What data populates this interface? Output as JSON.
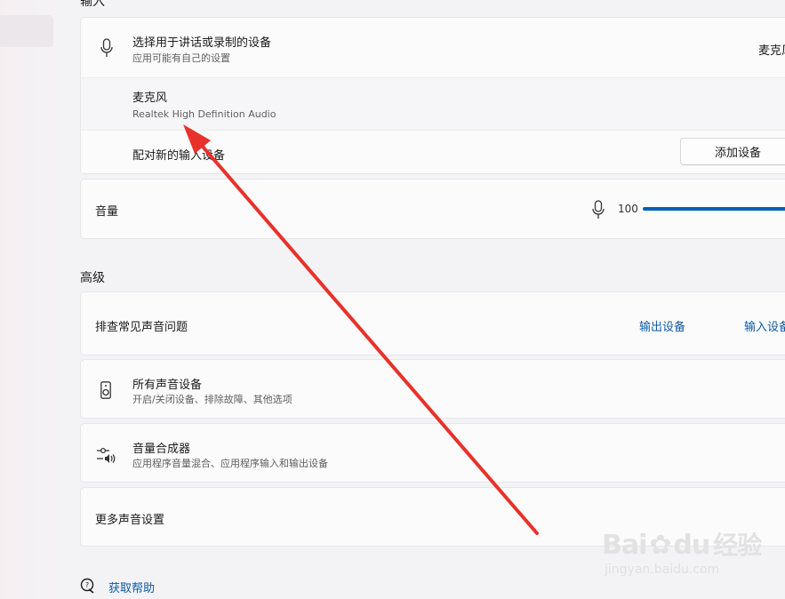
{
  "input_section": {
    "header": "输入",
    "choose_device_title": "选择用于讲话或录制的设备",
    "choose_device_sub": "应用可能有自己的设置",
    "selected_device_value": "麦克风",
    "mic_name": "麦克风",
    "mic_desc": "Realtek High Definition Audio",
    "pair_label": "配对新的输入设备",
    "add_device_button": "添加设备",
    "volume_label": "音量",
    "volume_value": "100",
    "volume_level_percent": 100
  },
  "advanced_section": {
    "header": "高级",
    "troubleshoot_label": "排查常见声音问题",
    "output_devices_link": "输出设备",
    "input_devices_link": "输入设备",
    "all_devices_title": "所有声音设备",
    "all_devices_sub": "开启/关闭设备、排除故障、其他选项",
    "mixer_title": "音量合成器",
    "mixer_sub": "应用程序音量混合、应用程序输入和输出设备",
    "more_settings": "更多声音设置"
  },
  "help": {
    "label": "获取帮助"
  },
  "watermark": {
    "brand": "Bai",
    "suffix": "du",
    "cn": "经验",
    "url": "jingyan.baidu.com"
  },
  "colors": {
    "accent": "#005fb8",
    "link": "#0e5a9e",
    "annotation_arrow": "#e8312a"
  },
  "icons": [
    "microphone-icon",
    "speaker-icon",
    "mixer-icon",
    "help-icon",
    "paw-icon"
  ]
}
